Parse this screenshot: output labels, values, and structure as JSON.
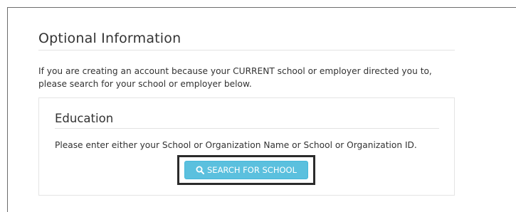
{
  "optional_info": {
    "title": "Optional Information",
    "intro_line1": "If you are creating an account because your CURRENT school or employer directed you to,",
    "intro_line2": "please search for your school or employer below."
  },
  "education": {
    "title": "Education",
    "instruction": "Please enter either your School or Organization Name or School or Organization ID.",
    "search_button_label": "SEARCH FOR SCHOOL",
    "search_button_icon": "search-icon"
  },
  "colors": {
    "button_bg": "#5bc0de",
    "button_text": "#ffffff",
    "highlight_border": "#2b2b2b",
    "text": "#333333"
  }
}
